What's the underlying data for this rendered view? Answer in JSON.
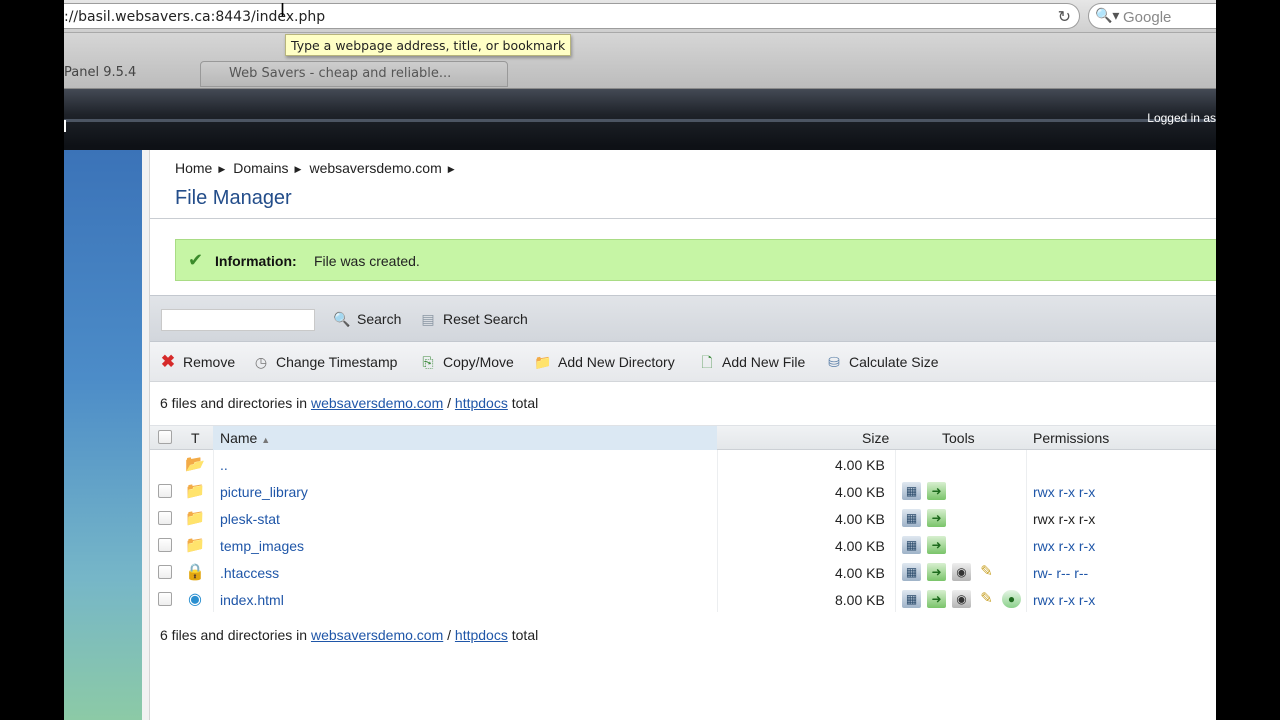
{
  "browser": {
    "url": "://basil.websavers.ca:8443/index.php",
    "search_placeholder": "Google",
    "tooltip": "Type a webpage address, title, or bookmark",
    "tabs": [
      "Panel 9.5.4",
      "Web Savers - cheap and reliable..."
    ]
  },
  "header": {
    "logged_in": "Logged in as"
  },
  "breadcrumb": [
    "Home",
    "Domains",
    "websaversdemo.com"
  ],
  "page_title": "File Manager",
  "info": {
    "label": "Information:",
    "message": "File was created."
  },
  "search": {
    "value": "",
    "search_label": "Search",
    "reset_label": "Reset Search"
  },
  "toolbar": {
    "remove": "Remove",
    "change_timestamp": "Change Timestamp",
    "copy_move": "Copy/Move",
    "add_dir": "Add New Directory",
    "add_file": "Add New File",
    "calc_size": "Calculate Size"
  },
  "summary": {
    "prefix": "6 files and directories in",
    "domain": "websaversdemo.com",
    "sep": "/",
    "dir": "httpdocs",
    "suffix": "total"
  },
  "table": {
    "headers": {
      "type": "T",
      "name": "Name",
      "size": "Size",
      "tools": "Tools",
      "permissions": "Permissions"
    },
    "rows": [
      {
        "name": "..",
        "size": "4.00 KB",
        "permissions": "",
        "icon": "folder-up-icon"
      },
      {
        "name": "picture_library",
        "size": "4.00 KB",
        "permissions": "rwx r-x r-x",
        "icon": "folder-icon"
      },
      {
        "name": "plesk-stat",
        "size": "4.00 KB",
        "permissions": "rwx r-x r-x",
        "icon": "folder-icon"
      },
      {
        "name": "temp_images",
        "size": "4.00 KB",
        "permissions": "rwx r-x r-x",
        "icon": "folder-icon"
      },
      {
        "name": ".htaccess",
        "size": "4.00 KB",
        "permissions": "rw- r-- r--",
        "icon": "locked-file-icon"
      },
      {
        "name": "index.html",
        "size": "8.00 KB",
        "permissions": "rwx r-x r-x",
        "icon": "html-file-icon"
      }
    ]
  },
  "colors": {
    "title": "#234d8a",
    "link": "#1f56a8",
    "info_bg": "#c6f5a5"
  }
}
